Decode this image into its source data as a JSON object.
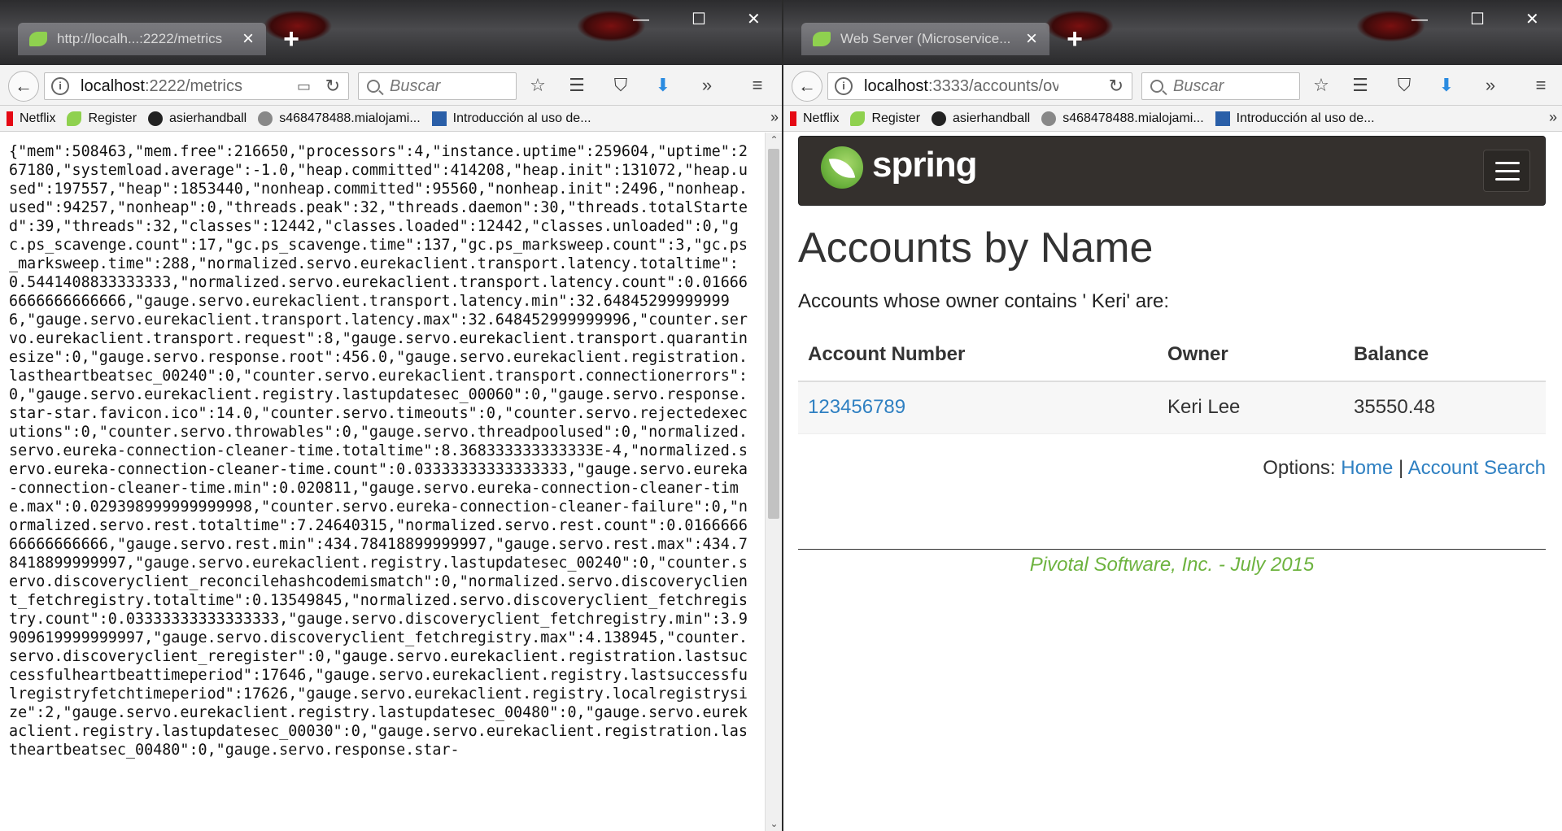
{
  "left_window": {
    "tab_title": "http://localh...:2222/metrics",
    "url_host": "localhost",
    "url_path": ":2222/metrics",
    "search_placeholder": "Buscar",
    "json_text": "{\"mem\":508463,\"mem.free\":216650,\"processors\":4,\"instance.uptime\":259604,\"uptime\":267180,\"systemload.average\":-1.0,\"heap.committed\":414208,\"heap.init\":131072,\"heap.used\":197557,\"heap\":1853440,\"nonheap.committed\":95560,\"nonheap.init\":2496,\"nonheap.used\":94257,\"nonheap\":0,\"threads.peak\":32,\"threads.daemon\":30,\"threads.totalStarted\":39,\"threads\":32,\"classes\":12442,\"classes.loaded\":12442,\"classes.unloaded\":0,\"gc.ps_scavenge.count\":17,\"gc.ps_scavenge.time\":137,\"gc.ps_marksweep.count\":3,\"gc.ps_marksweep.time\":288,\"normalized.servo.eurekaclient.transport.latency.totaltime\":0.5441408833333333,\"normalized.servo.eurekaclient.transport.latency.count\":0.016666666666666666,\"gauge.servo.eurekaclient.transport.latency.min\":32.648452999999996,\"gauge.servo.eurekaclient.transport.latency.max\":32.648452999999996,\"counter.servo.eurekaclient.transport.request\":8,\"gauge.servo.eurekaclient.transport.quarantinesize\":0,\"gauge.servo.response.root\":456.0,\"gauge.servo.eurekaclient.registration.lastheartbeatsec_00240\":0,\"counter.servo.eurekaclient.transport.connectionerrors\":0,\"gauge.servo.eurekaclient.registry.lastupdatesec_00060\":0,\"gauge.servo.response.star-star.favicon.ico\":14.0,\"counter.servo.timeouts\":0,\"counter.servo.rejectedexecutions\":0,\"counter.servo.throwables\":0,\"gauge.servo.threadpoolused\":0,\"normalized.servo.eureka-connection-cleaner-time.totaltime\":8.368333333333333E-4,\"normalized.servo.eureka-connection-cleaner-time.count\":0.03333333333333333,\"gauge.servo.eureka-connection-cleaner-time.min\":0.020811,\"gauge.servo.eureka-connection-cleaner-time.max\":0.029398999999999998,\"counter.servo.eureka-connection-cleaner-failure\":0,\"normalized.servo.rest.totaltime\":7.24640315,\"normalized.servo.rest.count\":0.016666666666666666,\"gauge.servo.rest.min\":434.78418899999997,\"gauge.servo.rest.max\":434.78418899999997,\"gauge.servo.eurekaclient.registry.lastupdatesec_00240\":0,\"counter.servo.discoveryclient_reconcilehashcodemismatch\":0,\"normalized.servo.discoveryclient_fetchregistry.totaltime\":0.13549845,\"normalized.servo.discoveryclient_fetchregistry.count\":0.03333333333333333,\"gauge.servo.discoveryclient_fetchregistry.min\":3.9909619999999997,\"gauge.servo.discoveryclient_fetchregistry.max\":4.138945,\"counter.servo.discoveryclient_reregister\":0,\"gauge.servo.eurekaclient.registration.lastsuccessfulheartbeattimeperiod\":17646,\"gauge.servo.eurekaclient.registry.lastsuccessfulregistryfetchtimeperiod\":17626,\"gauge.servo.eurekaclient.registry.localregistrysize\":2,\"gauge.servo.eurekaclient.registry.lastupdatesec_00480\":0,\"gauge.servo.eurekaclient.registry.lastupdatesec_00030\":0,\"gauge.servo.eurekaclient.registration.lastheartbeatsec_00480\":0,\"gauge.servo.response.star-"
  },
  "right_window": {
    "tab_title": "Web Server (Microservice...",
    "url_host": "localhost",
    "url_path": ":3333/accounts/ov",
    "search_placeholder": "Buscar"
  },
  "bookmarks": [
    "Netflix",
    "Register",
    "asierhandball",
    "s468478488.mialojami...",
    "Introducción al uso de..."
  ],
  "spring_page": {
    "brand": "spring",
    "heading": "Accounts by Name",
    "subtitle": "Accounts whose owner contains ' Keri' are:",
    "table": {
      "headers": [
        "Account Number",
        "Owner",
        "Balance"
      ],
      "rows": [
        [
          "123456789",
          "Keri Lee",
          "35550.48"
        ]
      ]
    },
    "options_label": "Options:",
    "link_home": "Home",
    "separator": "|",
    "link_search": "Account Search",
    "footer": "Pivotal Software, Inc. - July 2015"
  },
  "colors": {
    "spring_green": "#6db33f",
    "link_blue": "#2f80c2",
    "navbar_dark": "#34302d"
  }
}
